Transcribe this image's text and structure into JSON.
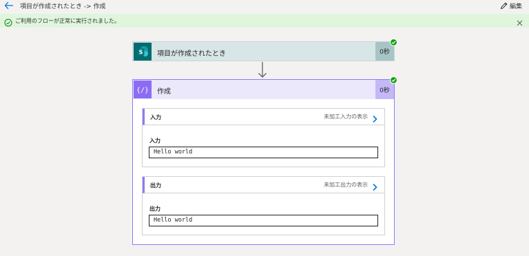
{
  "header": {
    "title": "項目が作成されたとき -> 作成",
    "edit_label": "編集"
  },
  "banner": {
    "message": "ご利用のフローが正常に実行されました。"
  },
  "trigger_card": {
    "label": "項目が作成されたとき",
    "duration": "0秒"
  },
  "action_card": {
    "label": "作成",
    "duration": "0秒",
    "sections": [
      {
        "title": "入力",
        "raw_link": "未加工入力の表示",
        "field_label": "入力",
        "value": "Hello world"
      },
      {
        "title": "出力",
        "raw_link": "未加工出力の表示",
        "field_label": "出力",
        "value": "Hello world"
      }
    ]
  },
  "colors": {
    "success_banner": "#dff6dd",
    "sharepoint": "#036c70",
    "compose": "#8c6cf2",
    "check": "#13a10e",
    "accent": "#0078d4"
  },
  "icons": [
    "back-arrow-icon",
    "edit-pencil-icon",
    "success-circle-icon",
    "close-icon",
    "sharepoint-icon",
    "compose-icon",
    "check-icon",
    "down-arrow-icon",
    "chevron-right-icon"
  ]
}
